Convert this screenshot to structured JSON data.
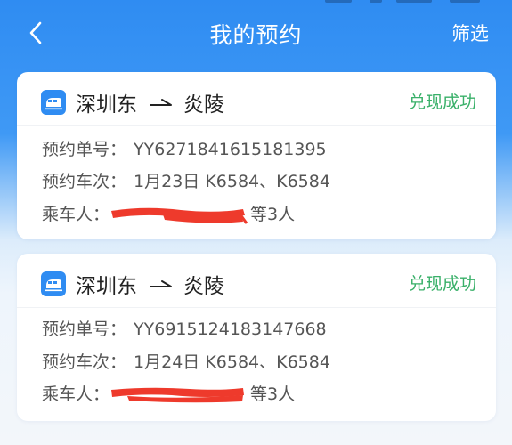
{
  "header": {
    "title": "我的预约",
    "filter_label": "筛选"
  },
  "colors": {
    "primary": "#2f8cf2",
    "success": "#39b069",
    "redact": "#ee3a2c"
  },
  "bookings": [
    {
      "from": "深圳东",
      "to": "炎陵",
      "status": "兑现成功",
      "order_label": "预约单号：",
      "order_no": "YY6271841615181395",
      "trains_label": "预约车次：",
      "trains": "1月23日 K6584、K6584",
      "passengers_label": "乘车人：",
      "passengers_suffix": "等3人"
    },
    {
      "from": "深圳东",
      "to": "炎陵",
      "status": "兑现成功",
      "order_label": "预约单号：",
      "order_no": "YY6915124183147668",
      "trains_label": "预约车次：",
      "trains": "1月24日 K6584、K6584",
      "passengers_label": "乘车人：",
      "passengers_suffix": "等3人"
    }
  ]
}
